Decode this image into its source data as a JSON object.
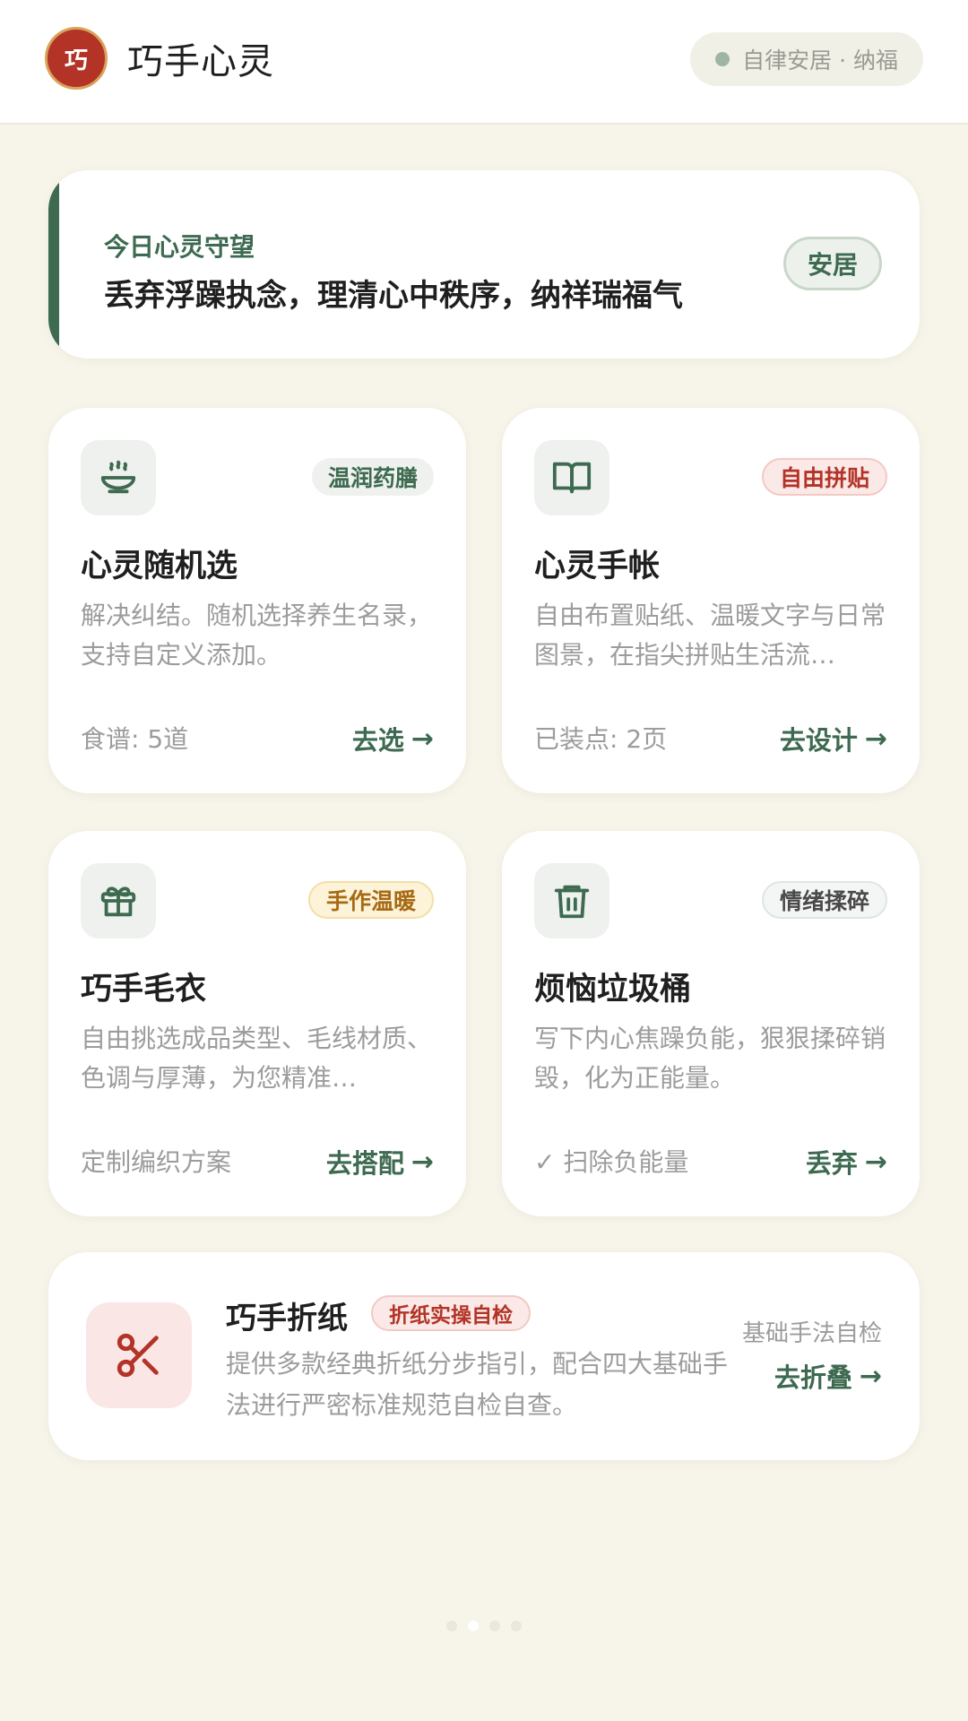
{
  "header": {
    "logo_char": "巧",
    "title": "巧手心灵",
    "status": "自律安居 · 纳福"
  },
  "guard": {
    "label": "今日心灵守望",
    "text": "丢弃浮躁执念，理清心中秩序，纳祥瑞福气",
    "badge": "安居"
  },
  "cards": [
    {
      "icon": "bowl-icon",
      "tag": "温润药膳",
      "title": "心灵随机选",
      "desc": "解决纠结。随机选择养生名录，支持自定义添加。",
      "meta": "食谱: 5道",
      "action": "去选"
    },
    {
      "icon": "book-icon",
      "tag": "自由拼贴",
      "title": "心灵手帐",
      "desc": "自由布置贴纸、温暖文字与日常图景，在指尖拼贴生活流…",
      "meta": "已装点: 2页",
      "action": "去设计"
    },
    {
      "icon": "gift-icon",
      "tag": "手作温暖",
      "title": "巧手毛衣",
      "desc": "自由挑选成品类型、毛线材质、色调与厚薄，为您精准…",
      "meta": "定制编织方案",
      "action": "去搭配"
    },
    {
      "icon": "trash-icon",
      "tag": "情绪揉碎",
      "title": "烦恼垃圾桶",
      "desc": "写下内心焦躁负能，狠狠揉碎销毁，化为正能量。",
      "meta": "✓ 扫除负能量",
      "action": "丢弃"
    }
  ],
  "fold": {
    "icon": "scissors-icon",
    "title": "巧手折纸",
    "tag": "折纸实操自检",
    "desc": "提供多款经典折纸分步指引，配合四大基础手法进行严密标准规范自检自查。",
    "side": "基础手法自检",
    "action": "去折叠"
  },
  "arrow": "→",
  "colors": {
    "accent": "#3d6a50",
    "brand_red": "#b33327",
    "background": "#f7f4ea"
  }
}
